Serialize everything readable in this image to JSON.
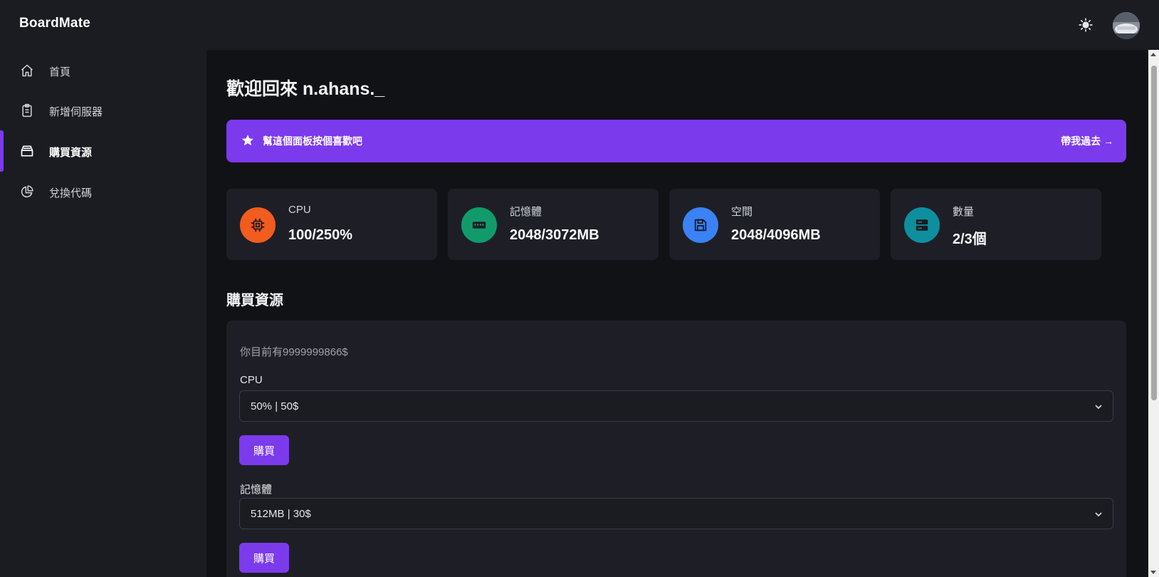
{
  "app": {
    "brand": "BoardMate"
  },
  "header": {
    "theme_icon": "sun-icon",
    "avatar_icon": "user-avatar"
  },
  "sidebar": {
    "items": [
      {
        "label": "首頁",
        "icon": "home-icon"
      },
      {
        "label": "新增伺服器",
        "icon": "clipboard-icon"
      },
      {
        "label": "購買資源",
        "icon": "inbox-icon",
        "active": true
      },
      {
        "label": "兌換代碼",
        "icon": "pie-chart-icon"
      }
    ]
  },
  "main": {
    "welcome": "歡迎回來 n.ahans._",
    "banner": {
      "text": "幫這個面板按個喜歡吧",
      "link": "帶我過去 →",
      "icon": "star-icon"
    },
    "stats": [
      {
        "label": "CPU",
        "value": "100/250%",
        "icon": "cpu-icon",
        "color": "#f25c1e"
      },
      {
        "label": "記憶體",
        "value": "2048/3072MB",
        "icon": "memory-icon",
        "color": "#119b6b"
      },
      {
        "label": "空間",
        "value": "2048/4096MB",
        "icon": "save-icon",
        "color": "#3b82f6"
      },
      {
        "label": "數量",
        "value": "2/3個",
        "icon": "server-icon",
        "color": "#0e8f9e"
      }
    ],
    "section_title": "購買資源",
    "purchase": {
      "balance": "你目前有9999999866$",
      "fields": [
        {
          "label": "CPU",
          "selected": "50% | 50$",
          "button": "購買"
        },
        {
          "label": "記憶體",
          "selected": "512MB | 30$",
          "button": "購買"
        }
      ]
    }
  },
  "colors": {
    "accent": "#7c3aed",
    "background": "#111216",
    "surface": "#1e1f26",
    "sidebar": "#1b1c22"
  }
}
